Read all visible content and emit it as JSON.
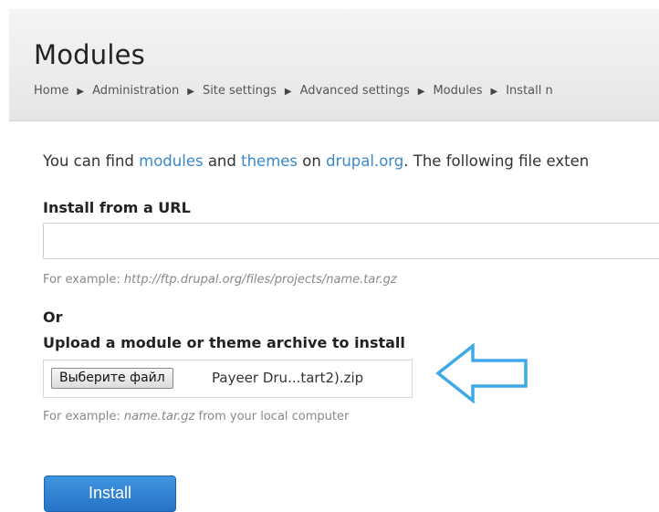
{
  "header": {
    "title": "Modules",
    "breadcrumb": [
      {
        "label": "Home"
      },
      {
        "label": "Administration"
      },
      {
        "label": "Site settings"
      },
      {
        "label": "Advanced settings"
      },
      {
        "label": "Modules"
      },
      {
        "label": "Install n"
      }
    ],
    "separator": "▶"
  },
  "intro": {
    "text_1": "You can find ",
    "link_modules": "modules",
    "text_2": " and ",
    "link_themes": "themes",
    "text_3": " on ",
    "link_drupal": "drupal.org",
    "text_4": ". The following file exten"
  },
  "install_url": {
    "label": "Install from a URL",
    "value": "",
    "help_prefix": "For example: ",
    "help_example": "http://ftp.drupal.org/files/projects/name.tar.gz"
  },
  "or_label": "Or",
  "upload": {
    "label": "Upload a module or theme archive to install",
    "button_label": "Выберите файл",
    "file_name": "Payeer Dru...tart2).zip",
    "help_example": "name.tar.gz",
    "help_suffix": " from your local computer"
  },
  "install_button": "Install",
  "colors": {
    "link": "#3b88c8",
    "arrow": "#3fa9e8",
    "button": "#2f82d6"
  },
  "icons": {
    "pointer_arrow": "arrow-left-icon"
  }
}
